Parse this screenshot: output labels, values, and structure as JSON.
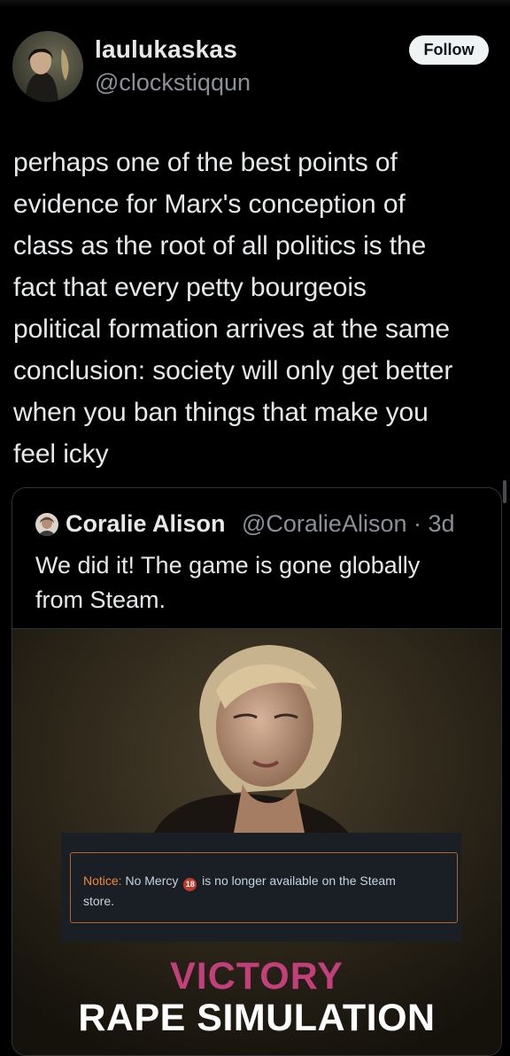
{
  "author": {
    "display_name": "laulukaskas",
    "handle": "@clockstiqqun",
    "follow_label": "Follow"
  },
  "tweet": {
    "lines": [
      "perhaps one of the best points of",
      "evidence for Marx's conception of",
      "class as the root of all politics is the",
      "fact that every petty bourgeois",
      "political formation arrives at the same",
      "conclusion: society will only get better",
      "when you ban things that make you",
      "feel icky"
    ]
  },
  "quoted": {
    "display_name": "Coralie Alison",
    "handle_time": "@CoralieAlison · 3d",
    "text_lines": [
      "We did it! The game is gone globally",
      "from Steam."
    ],
    "media": {
      "notice_label": "Notice:",
      "notice_text_1": "No Mercy",
      "age_badge": "18",
      "notice_text_2": "is no longer available on the Steam",
      "notice_text_3": "store.",
      "victory": "VICTORY",
      "banner": "RAPE SIMULATION"
    }
  },
  "icons": {
    "avatar": "profile-photo",
    "quote_avatar": "profile-photo",
    "age_rating": "age-18-badge"
  },
  "colors": {
    "background": "#000000",
    "follow_bg": "#eff3f4",
    "muted_text": "#8b9096",
    "notice_orange": "#f08a3a",
    "victory_pink": "#c2407a"
  }
}
